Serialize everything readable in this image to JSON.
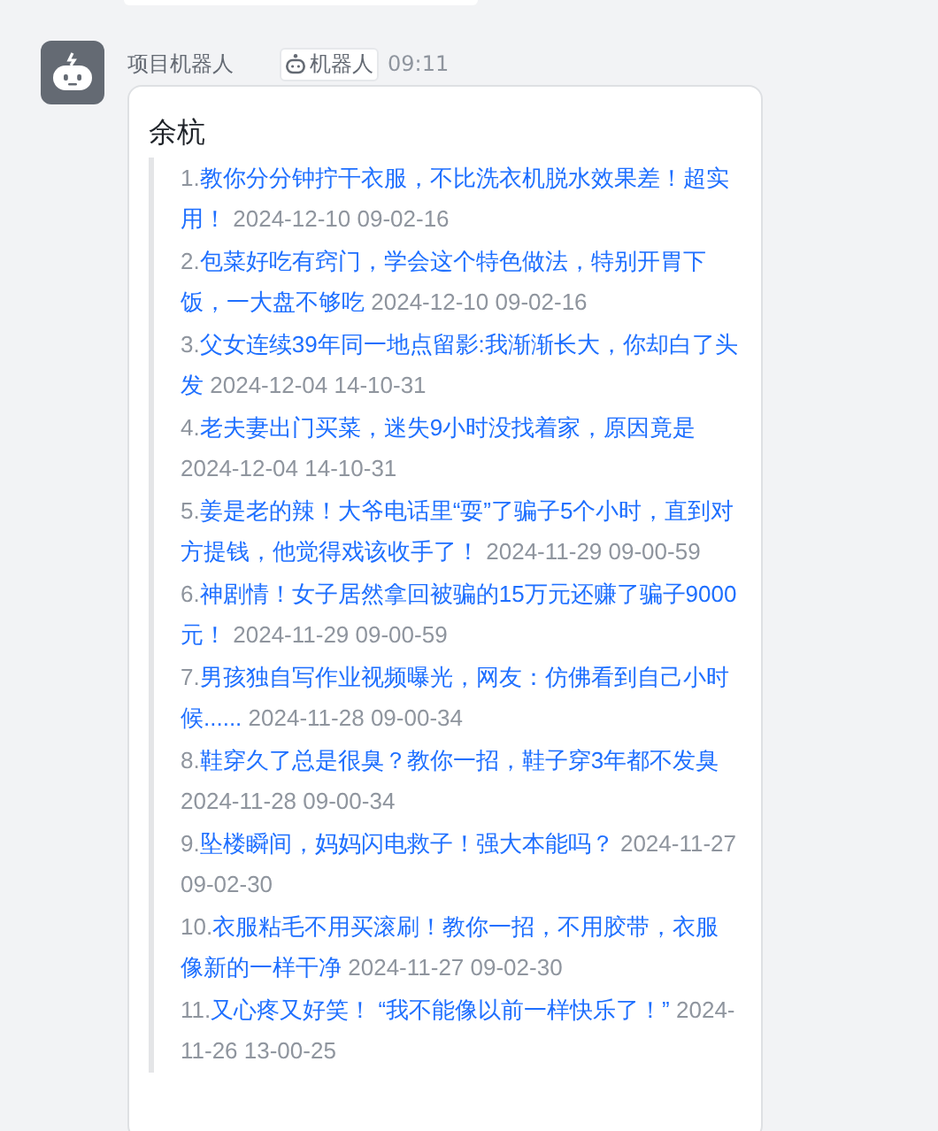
{
  "message": {
    "sender": "项目机器人",
    "badge": "机器人",
    "time": "09:11"
  },
  "card": {
    "title": "余杭",
    "items": [
      {
        "index": "1.",
        "title": "教你分分钟拧干衣服，不比洗衣机脱水效果差！超实用！",
        "date": "2024-12-10 09-02-16"
      },
      {
        "index": "2.",
        "title": "包菜好吃有窍门，学会这个特色做法，特别开胃下饭，一大盘不够吃",
        "date": "2024-12-10 09-02-16"
      },
      {
        "index": "3.",
        "title": "父女连续39年同一地点留影:我渐渐长大，你却白了头发",
        "date": "2024-12-04 14-10-31"
      },
      {
        "index": "4.",
        "title": "老夫妻出门买菜，迷失9小时没找着家，原因竟是",
        "date": "2024-12-04 14-10-31"
      },
      {
        "index": "5.",
        "title": "姜是老的辣！大爷电话里“耍”了骗子5个小时，直到对方提钱，他觉得戏该收手了！",
        "date": "2024-11-29 09-00-59"
      },
      {
        "index": "6.",
        "title": "神剧情！女子居然拿回被骗的15万元还赚了骗子9000元！",
        "date": "2024-11-29 09-00-59"
      },
      {
        "index": "7.",
        "title": "男孩独自写作业视频曝光，网友：仿佛看到自己小时候......",
        "date": "2024-11-28 09-00-34"
      },
      {
        "index": "8.",
        "title": "鞋穿久了总是很臭？教你一招，鞋子穿3年都不发臭",
        "date": "2024-11-28 09-00-34"
      },
      {
        "index": "9.",
        "title": "坠楼瞬间，妈妈闪电救子！强大本能吗？",
        "date": "2024-11-27 09-02-30"
      },
      {
        "index": "10.",
        "title": "衣服粘毛不用买滚刷！教你一招，不用胶带，衣服像新的一样干净",
        "date": "2024-11-27 09-02-30"
      },
      {
        "index": "11.",
        "title": "又心疼又好笑！ “我不能像以前一样快乐了！”",
        "date": "2024-11-26 13-00-25"
      }
    ]
  }
}
